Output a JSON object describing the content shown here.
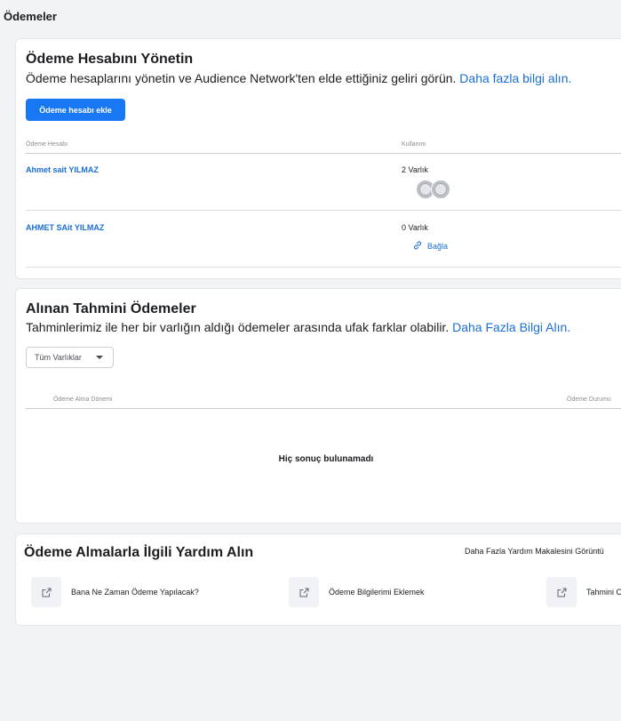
{
  "page": {
    "title": "Ödemeler"
  },
  "manage": {
    "title": "Ödeme Hesabını Yönetin",
    "subtitle": "Ödeme hesaplarını yönetin ve Audience Network'ten elde ettiğiniz geliri görün.",
    "link": "Daha fazla bilgi alın.",
    "add_button": "Ödeme hesabı ekle",
    "col_account": "Ödeme Hesabı",
    "col_usage": "Kullanım",
    "rows": [
      {
        "name": "Ahmet sait YILMAZ",
        "usage": "2 Varlık"
      },
      {
        "name": "AHMET SAit YILMAZ",
        "usage": "0 Varlık",
        "action": "Bağla"
      }
    ]
  },
  "estimated": {
    "title": "Alınan Tahmini Ödemeler",
    "subtitle": "Tahminlerimiz ile her bir varlığın aldığı ödemeler arasında ufak farklar olabilir.",
    "link": "Daha Fazla Bilgi Alın.",
    "filter": "Tüm Varlıklar",
    "col_period": "Ödeme Alma Dönemi",
    "col_status": "Ödeme Durumu",
    "empty": "Hiç sonuç bulunamadı"
  },
  "help": {
    "title": "Ödeme Almalarla İlgili Yardım Alın",
    "more": "Daha Fazla Yardım Makalesini Görüntü",
    "items": [
      {
        "label": "Bana Ne Zaman Ödeme Yapılacak?",
        "icon": "external-link-icon"
      },
      {
        "label": "Ödeme Bilgilerimi Eklemek",
        "icon": "external-link-icon"
      },
      {
        "label": "Tahmini C",
        "icon": "external-link-icon"
      }
    ]
  },
  "colors": {
    "accent": "#1877f2",
    "link": "#1a6fd3",
    "background": "#f2f3f5"
  }
}
